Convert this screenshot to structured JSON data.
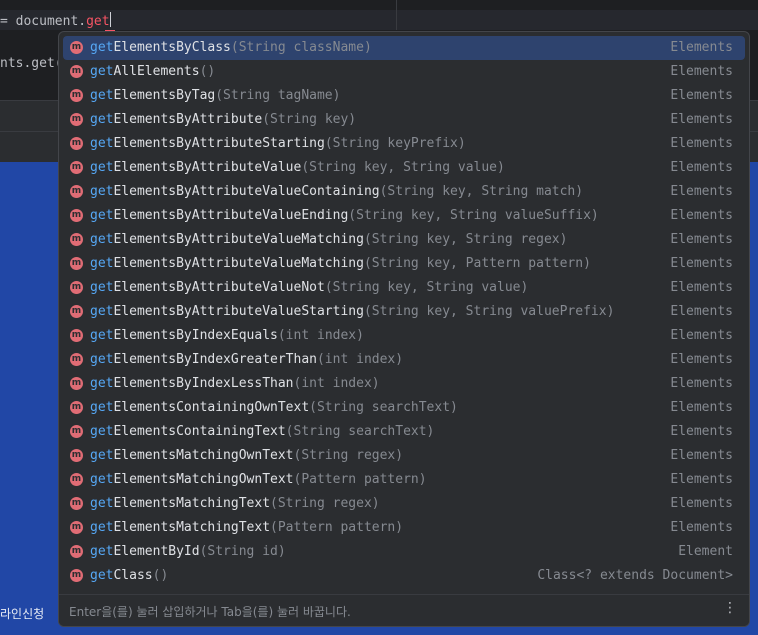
{
  "editor": {
    "line1_prefix": "= document.",
    "line1_typed": "get",
    "line2_fragment": "nts.get("
  },
  "background": {
    "korean_fragment": "라인신청"
  },
  "popup": {
    "icon_letter": "m",
    "footer_hint": "Enter을(를) 눌러 삽입하거나 Tab을(를) 눌러 바꿉니다.",
    "menu_glyph": "⋮",
    "items": [
      {
        "prefix": "get",
        "rest": "ElementsByClass",
        "params": "(String className)",
        "type": "Elements",
        "selected": true
      },
      {
        "prefix": "get",
        "rest": "AllElements",
        "params": "()",
        "type": "Elements"
      },
      {
        "prefix": "get",
        "rest": "ElementsByTag",
        "params": "(String tagName)",
        "type": "Elements"
      },
      {
        "prefix": "get",
        "rest": "ElementsByAttribute",
        "params": "(String key)",
        "type": "Elements"
      },
      {
        "prefix": "get",
        "rest": "ElementsByAttributeStarting",
        "params": "(String keyPrefix)",
        "type": "Elements"
      },
      {
        "prefix": "get",
        "rest": "ElementsByAttributeValue",
        "params": "(String key, String value)",
        "type": "Elements"
      },
      {
        "prefix": "get",
        "rest": "ElementsByAttributeValueContaining",
        "params": "(String key, String match)",
        "type": "Elements"
      },
      {
        "prefix": "get",
        "rest": "ElementsByAttributeValueEnding",
        "params": "(String key, String valueSuffix)",
        "type": "Elements"
      },
      {
        "prefix": "get",
        "rest": "ElementsByAttributeValueMatching",
        "params": "(String key, String regex)",
        "type": "Elements"
      },
      {
        "prefix": "get",
        "rest": "ElementsByAttributeValueMatching",
        "params": "(String key, Pattern pattern)",
        "type": "Elements"
      },
      {
        "prefix": "get",
        "rest": "ElementsByAttributeValueNot",
        "params": "(String key, String value)",
        "type": "Elements"
      },
      {
        "prefix": "get",
        "rest": "ElementsByAttributeValueStarting",
        "params": "(String key, String valuePrefix)",
        "type": "Elements"
      },
      {
        "prefix": "get",
        "rest": "ElementsByIndexEquals",
        "params": "(int index)",
        "type": "Elements"
      },
      {
        "prefix": "get",
        "rest": "ElementsByIndexGreaterThan",
        "params": "(int index)",
        "type": "Elements"
      },
      {
        "prefix": "get",
        "rest": "ElementsByIndexLessThan",
        "params": "(int index)",
        "type": "Elements"
      },
      {
        "prefix": "get",
        "rest": "ElementsContainingOwnText",
        "params": "(String searchText)",
        "type": "Elements"
      },
      {
        "prefix": "get",
        "rest": "ElementsContainingText",
        "params": "(String searchText)",
        "type": "Elements"
      },
      {
        "prefix": "get",
        "rest": "ElementsMatchingOwnText",
        "params": "(String regex)",
        "type": "Elements"
      },
      {
        "prefix": "get",
        "rest": "ElementsMatchingOwnText",
        "params": "(Pattern pattern)",
        "type": "Elements"
      },
      {
        "prefix": "get",
        "rest": "ElementsMatchingText",
        "params": "(String regex)",
        "type": "Elements"
      },
      {
        "prefix": "get",
        "rest": "ElementsMatchingText",
        "params": "(Pattern pattern)",
        "type": "Elements"
      },
      {
        "prefix": "get",
        "rest": "ElementById",
        "params": "(String id)",
        "type": "Element"
      },
      {
        "prefix": "get",
        "rest": "Class",
        "params": "()",
        "type": "Class<? extends Document>"
      }
    ]
  },
  "colors": {
    "selected_row": "#2e436e",
    "match_highlight": "#56a8f5",
    "method_icon": "#e06c75",
    "blue_panel": "#2147a6"
  }
}
